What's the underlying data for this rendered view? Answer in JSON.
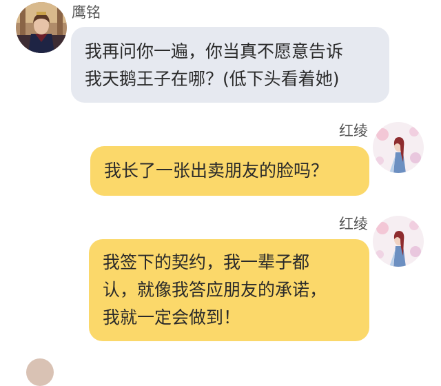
{
  "messages": [
    {
      "sender": "鹰铭",
      "side": "left",
      "avatar_icon": "prince-avatar-icon",
      "lines": [
        "我再问你一遍，你当真不愿意告诉",
        "我天鹅王子在哪？(低下头看着她)"
      ]
    },
    {
      "sender": "红绫",
      "side": "right",
      "avatar_icon": "girl-avatar-icon",
      "lines": [
        "我长了一张出卖朋友的脸吗？"
      ]
    },
    {
      "sender": "红绫",
      "side": "right",
      "avatar_icon": "girl-avatar-icon",
      "lines": [
        "我签下的契约，我一辈子都",
        "认，就像我答应朋友的承诺，",
        "我就一定会做到！"
      ]
    }
  ],
  "colors": {
    "left_bubble": "#e6e9f0",
    "right_bubble": "#fbd86a",
    "text": "#2a2a2a",
    "name": "#555555"
  }
}
